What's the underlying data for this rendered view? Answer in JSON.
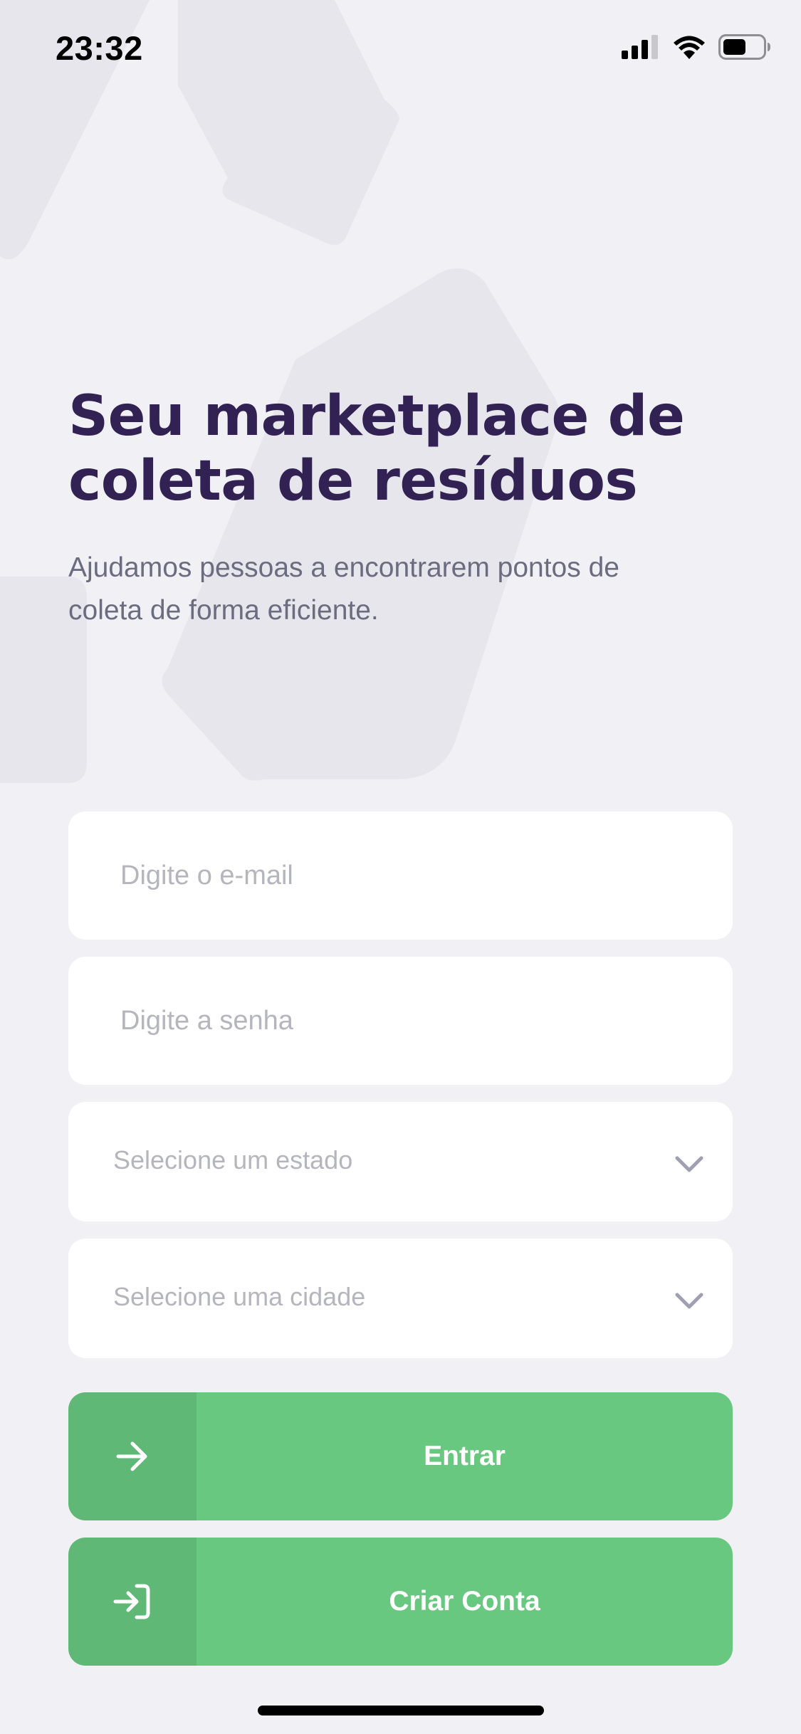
{
  "status_bar": {
    "time": "23:32"
  },
  "hero": {
    "title_line1": "Seu marketplace de",
    "title_line2": "coleta de resíduos",
    "subtitle_line1": "Ajudamos pessoas a encontrarem pontos de",
    "subtitle_line2": "coleta de forma eficiente."
  },
  "form": {
    "email_placeholder": "Digite o e-mail",
    "password_placeholder": "Digite a senha",
    "state_select": "Selecione um estado",
    "city_select": "Selecione uma cidade"
  },
  "buttons": {
    "login_label": "Entrar",
    "signup_label": "Criar Conta"
  },
  "icons": {
    "login": "arrow-right-icon",
    "signup": "log-in-icon",
    "dropdown": "chevron-down-icon"
  },
  "colors": {
    "background": "#F0F0F5",
    "title": "#322153",
    "subtitle": "#6C6C80",
    "primary": "#68C880",
    "placeholder": "#B5B5BE"
  }
}
